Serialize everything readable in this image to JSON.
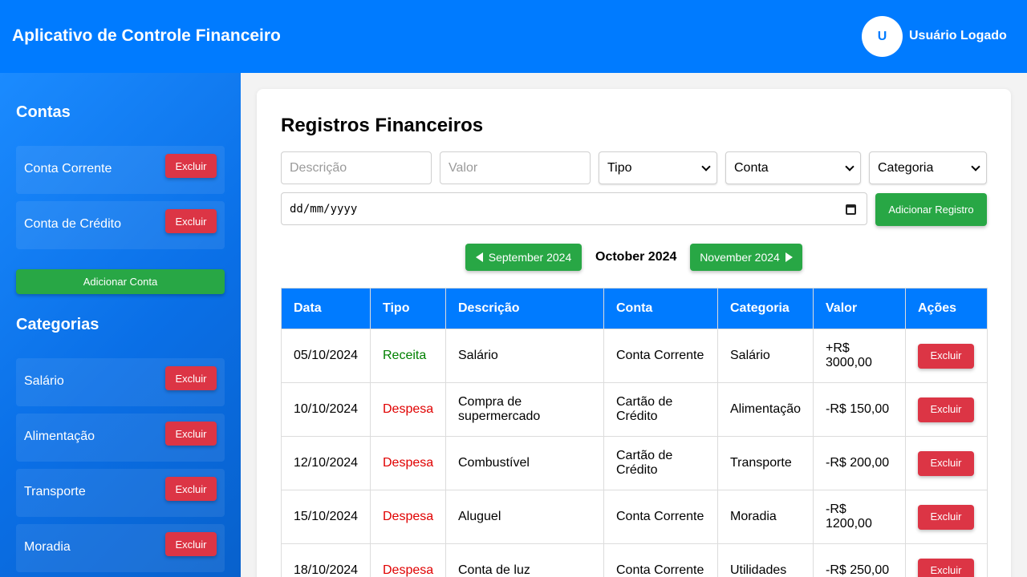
{
  "header": {
    "title": "Aplicativo de Controle Financeiro",
    "avatar_initial": "U",
    "user_name": "Usuário Logado"
  },
  "sidebar": {
    "accounts_heading": "Contas",
    "accounts": [
      {
        "label": "Conta Corrente",
        "delete_label": "Excluir"
      },
      {
        "label": "Conta de Crédito",
        "delete_label": "Excluir"
      }
    ],
    "add_account_label": "Adicionar Conta",
    "categories_heading": "Categorias",
    "categories": [
      {
        "label": "Salário",
        "delete_label": "Excluir"
      },
      {
        "label": "Alimentação",
        "delete_label": "Excluir"
      },
      {
        "label": "Transporte",
        "delete_label": "Excluir"
      },
      {
        "label": "Moradia",
        "delete_label": "Excluir"
      }
    ]
  },
  "main": {
    "title": "Registros Financeiros",
    "form": {
      "description_placeholder": "Descrição",
      "value_placeholder": "Valor",
      "type_selected": "Tipo",
      "account_selected": "Conta",
      "category_selected": "Categoria",
      "date_placeholder": "dd/mm/yyyy",
      "add_label": "Adicionar Registro"
    },
    "month_nav": {
      "prev_label": "September 2024",
      "current_label": "October 2024",
      "next_label": "November 2024"
    },
    "table": {
      "headers": [
        "Data",
        "Tipo",
        "Descrição",
        "Conta",
        "Categoria",
        "Valor",
        "Ações"
      ],
      "rows": [
        {
          "date": "05/10/2024",
          "type": "Receita",
          "description": "Salário",
          "account": "Conta Corrente",
          "category": "Salário",
          "value": "+R$ 3000,00",
          "action": "Excluir"
        },
        {
          "date": "10/10/2024",
          "type": "Despesa",
          "description": "Compra de supermercado",
          "account": "Cartão de Crédito",
          "category": "Alimentação",
          "value": "-R$ 150,00",
          "action": "Excluir"
        },
        {
          "date": "12/10/2024",
          "type": "Despesa",
          "description": "Combustível",
          "account": "Cartão de Crédito",
          "category": "Transporte",
          "value": "-R$ 200,00",
          "action": "Excluir"
        },
        {
          "date": "15/10/2024",
          "type": "Despesa",
          "description": "Aluguel",
          "account": "Conta Corrente",
          "category": "Moradia",
          "value": "-R$ 1200,00",
          "action": "Excluir"
        },
        {
          "date": "18/10/2024",
          "type": "Despesa",
          "description": "Conta de luz",
          "account": "Conta Corrente",
          "category": "Utilidades",
          "value": "-R$ 250,00",
          "action": "Excluir"
        }
      ]
    }
  },
  "colors": {
    "primary": "#007bff",
    "success": "#28a745",
    "danger": "#dc3545",
    "income_text": "#008000",
    "expense_text": "#e00000"
  }
}
